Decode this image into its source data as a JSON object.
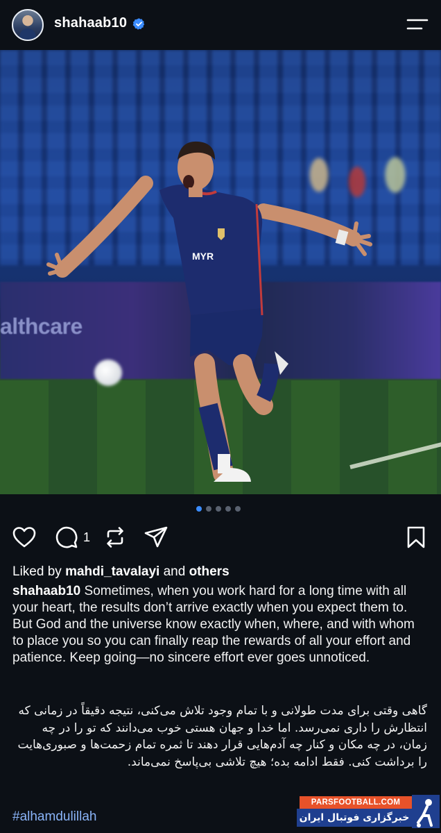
{
  "header": {
    "username": "shahaab10",
    "verified_icon": "verified-badge-icon",
    "menu_icon": "menu-icon"
  },
  "carousel": {
    "total": 5,
    "active": 1
  },
  "actions": {
    "like_icon": "heart-icon",
    "comment_icon": "comment-icon",
    "comment_count": "1",
    "repost_icon": "repost-icon",
    "share_icon": "send-icon",
    "save_icon": "bookmark-icon"
  },
  "photo": {
    "board_text": "althcare",
    "jersey_text": "MYR"
  },
  "likes": {
    "prefix": "Liked by",
    "user": "mahdi_tavalayi",
    "middle": "and",
    "others": "others"
  },
  "caption": {
    "user": "shahaab10",
    "text": "Sometimes, when you work hard for a long time with all your heart, the results don’t arrive exactly when you expect them to. But God and the universe know exactly when, where, and with whom to place you so you can finally reap the rewards of all your effort and patience. Keep going—no sincere effort ever goes unnoticed.",
    "persian": "گاهی وقتی برای مدت طولانی و با تمام وجود تلاش می‌کنی، نتیجه دقیقاً در زمانی که انتظارش را داری نمی‌رسد. اما خدا و جهان هستی خوب می‌دانند که تو را در چه زمان، در چه مکان و کنار چه آدم‌هایی قرار دهند تا ثمره تمام زحمت‌ها و صبوری‌هایت را برداشت کنی. فقط ادامه بده؛ هیچ تلاشی بی‌پاسخ نمی‌ماند.",
    "hashtag": "#alhamdulillah"
  },
  "watermark": {
    "top": "PARSFOOTBALL.COM",
    "bottom": "خبرگزاری فوتبال ایران",
    "logo_icon": "parsfootball-logo-icon"
  },
  "colors": {
    "background": "#0c1016",
    "link": "#8ab4f8",
    "verified": "#3b8cff",
    "active_dot": "#3b8cff",
    "watermark_orange": "#e7522a",
    "watermark_blue": "#1f3f8f"
  }
}
